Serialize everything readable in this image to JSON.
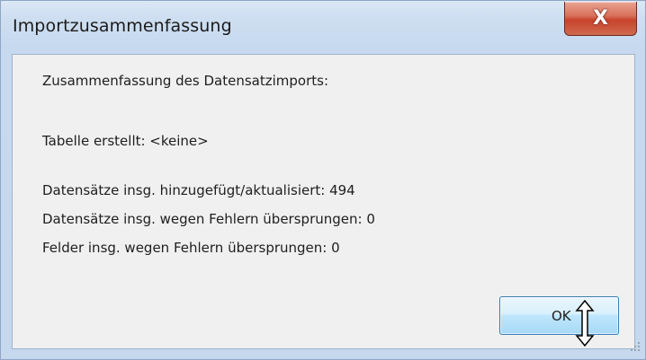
{
  "window": {
    "title": "Importzusammenfassung",
    "close_label": "X"
  },
  "summary": {
    "heading": "Zusammenfassung des Datensatzimports:",
    "table_created": "Tabelle erstellt: <keine>",
    "records_added": "Datensätze insg. hinzugefügt/aktualisiert: 494",
    "records_skipped": "Datensätze insg. wegen Fehlern übersprungen: 0",
    "fields_skipped": "Felder insg. wegen Fehlern übersprungen: 0"
  },
  "buttons": {
    "ok_label": "OK"
  },
  "icons": {
    "cursor": "vertical-resize-cursor",
    "grip": "size-grip"
  }
}
